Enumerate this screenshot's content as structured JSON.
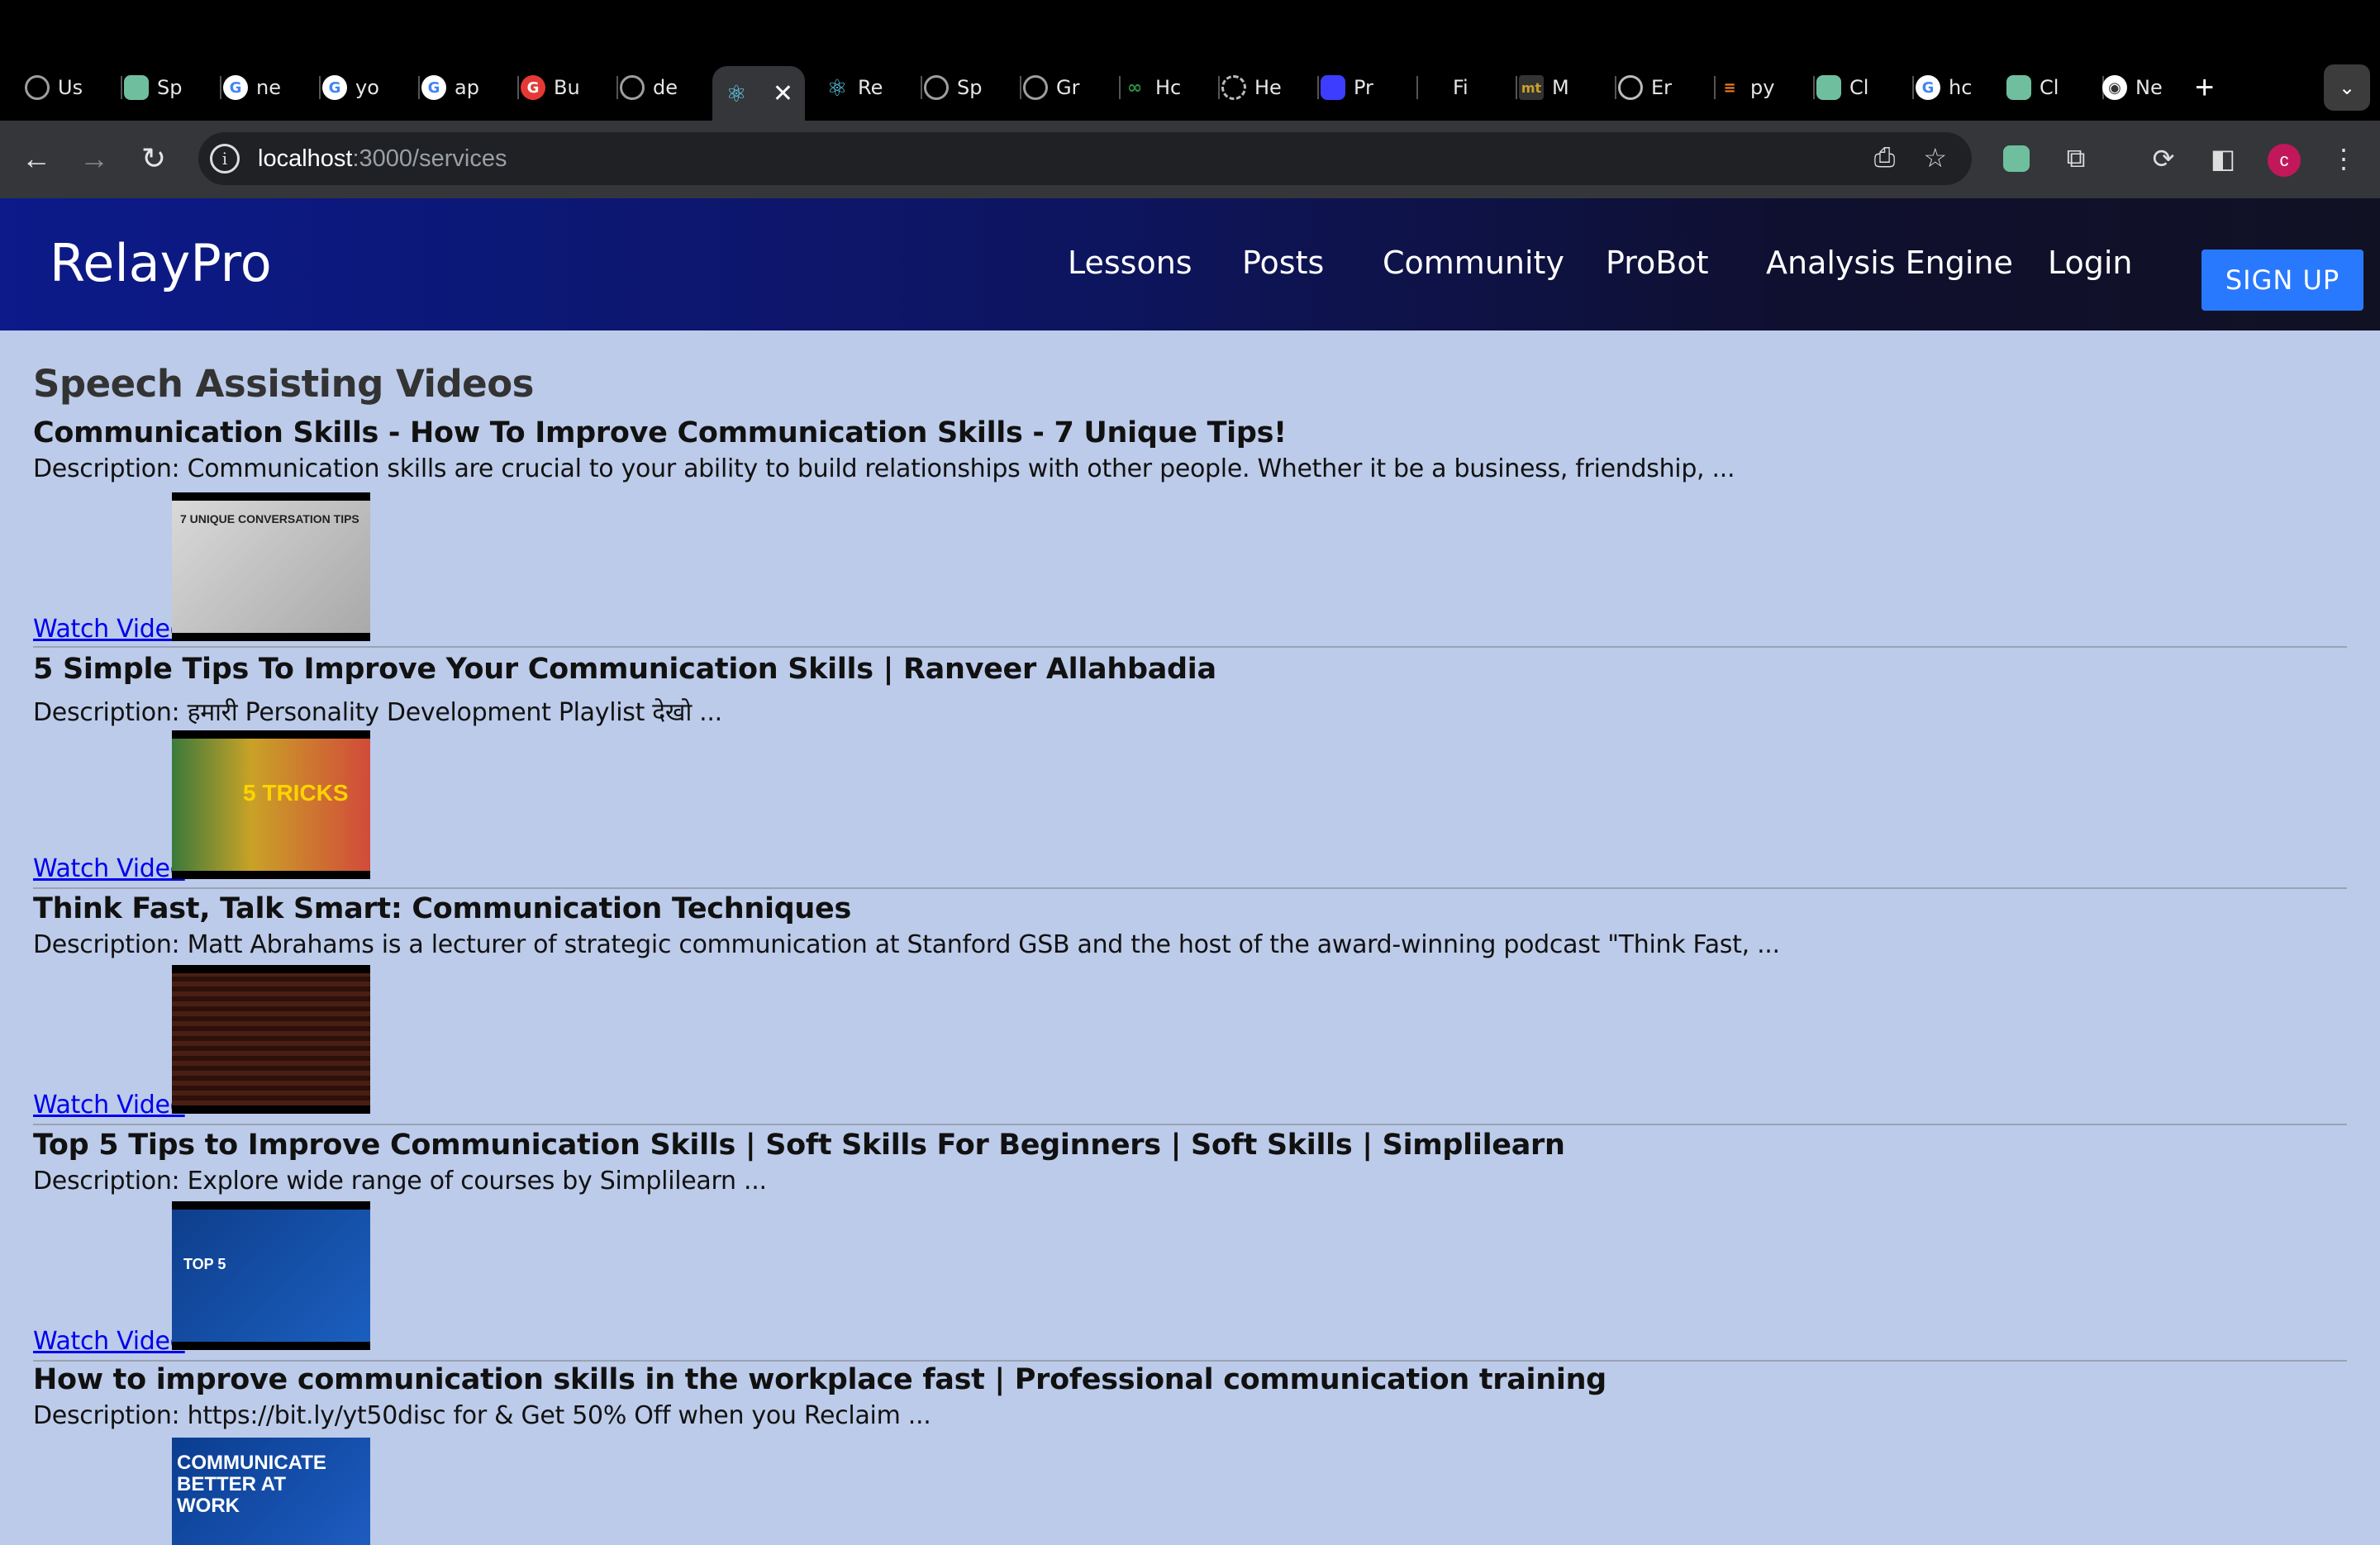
{
  "browser": {
    "tabs": [
      {
        "label": "Us",
        "icon": "settings-icon",
        "color": "#9e9e9e"
      },
      {
        "label": "Sp",
        "icon": "openai-icon",
        "color": "#6fbf9f"
      },
      {
        "label": "ne",
        "icon": "google-icon",
        "color": "#ffffff"
      },
      {
        "label": "yo",
        "icon": "google-icon",
        "color": "#ffffff"
      },
      {
        "label": "ap",
        "icon": "google-icon",
        "color": "#ffffff"
      },
      {
        "label": "Bu",
        "icon": "grammarly-icon",
        "color": "#e53935"
      },
      {
        "label": "de",
        "icon": "settings-icon",
        "color": "#9e9e9e"
      },
      {
        "label": "",
        "icon": "react-icon",
        "color": "#61dafb",
        "active": true
      },
      {
        "label": "Re",
        "icon": "react-icon",
        "color": "#61dafb"
      },
      {
        "label": "Sp",
        "icon": "settings-icon",
        "color": "#9e9e9e"
      },
      {
        "label": "Gr",
        "icon": "settings-icon",
        "color": "#9e9e9e"
      },
      {
        "label": "Hc",
        "icon": "geeks-icon",
        "color": "#2f8d46"
      },
      {
        "label": "He",
        "icon": "loading-icon",
        "color": "#bbbbbb"
      },
      {
        "label": "Pr",
        "icon": "openai-icon",
        "color": "#3d3dff"
      },
      {
        "label": "Fi",
        "icon": "blank-icon",
        "color": "#000000"
      },
      {
        "label": "M",
        "icon": "mt-icon",
        "color": "#c9a227"
      },
      {
        "label": "Er",
        "icon": "globe-icon",
        "color": "#bbbbbb"
      },
      {
        "label": "py",
        "icon": "stackoverflow-icon",
        "color": "#f48024"
      },
      {
        "label": "Cl",
        "icon": "openai-icon",
        "color": "#6fbf9f"
      },
      {
        "label": "hc",
        "icon": "google-icon",
        "color": "#ffffff"
      },
      {
        "label": "Cl",
        "icon": "openai-icon",
        "color": "#6fbf9f"
      },
      {
        "label": "Ne",
        "icon": "chrome-icon",
        "color": "#ffffff"
      }
    ],
    "url_host": "localhost",
    "url_path": ":3000/services"
  },
  "header": {
    "brand": "RelayPro",
    "nav": [
      "Lessons",
      "Posts",
      "Community",
      "ProBot",
      "Analysis Engine",
      "Login"
    ],
    "signup": "SIGN UP"
  },
  "section_title": "Speech Assisting Videos",
  "videos": [
    {
      "title": "Communication Skills - How To Improve Communication Skills - 7 Unique Tips!",
      "description": "Description: Communication skills are crucial to your ability to build relationships with other people. Whether it be a business, friendship, ...",
      "watch": "Watch Video",
      "thumb_text": "7 UNIQUE CONVERSATION TIPS"
    },
    {
      "title": "5 Simple Tips To Improve Your Communication Skills | Ranveer Allahbadia",
      "description": "Description: हमारी Personality Development Playlist देखो ...",
      "watch": "Watch Video",
      "thumb_text": "5 TRICKS"
    },
    {
      "title": "Think Fast, Talk Smart: Communication Techniques",
      "description": "Description: Matt Abrahams is a lecturer of strategic communication at Stanford GSB and the host of the award-winning podcast \"Think Fast, ...",
      "watch": "Watch Video",
      "thumb_text": ""
    },
    {
      "title": "Top 5 Tips to Improve Communication Skills | Soft Skills For Beginners | Soft Skills | Simplilearn",
      "description": "Description: Explore wide range of courses by Simplilearn ...",
      "watch": "Watch Video",
      "thumb_text": "TOP 5"
    },
    {
      "title": "How to improve communication skills in the workplace fast | Professional communication training",
      "description": "Description: https://bit.ly/yt50disc for & Get 50% Off when you Reclaim ...",
      "watch": "",
      "thumb_text": "COMMUNICATE BETTER AT WORK"
    }
  ]
}
